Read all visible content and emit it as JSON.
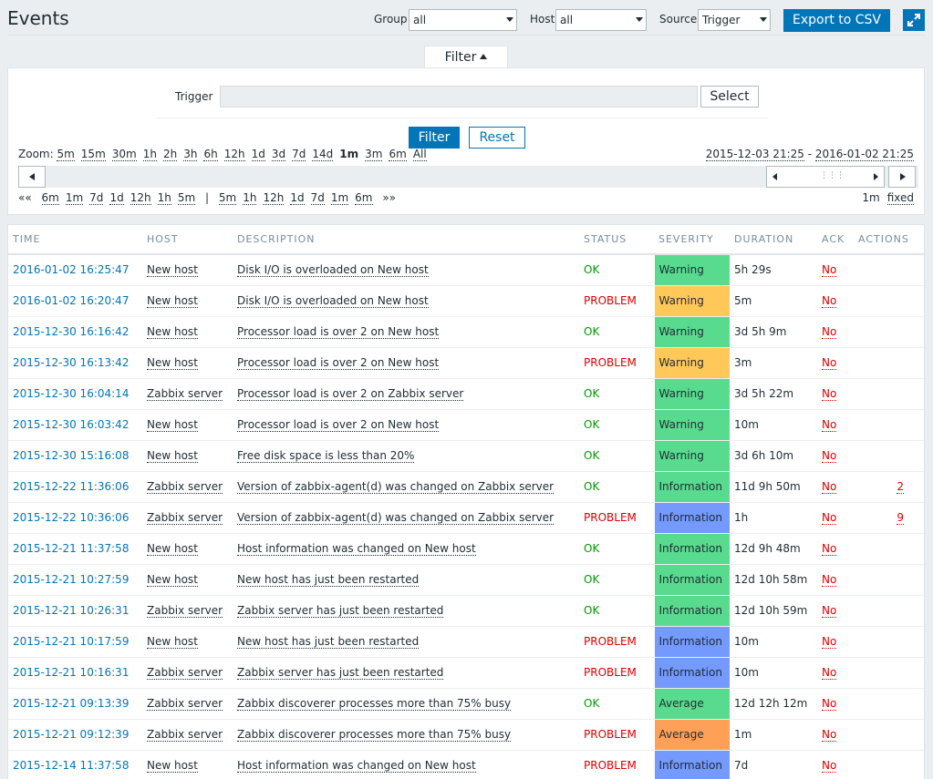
{
  "header": {
    "title": "Events",
    "group_label": "Group",
    "group_value": "all",
    "host_label": "Host",
    "host_value": "all",
    "source_label": "Source",
    "source_value": "Trigger",
    "export_label": "Export to CSV"
  },
  "filter": {
    "tab_label": "Filter",
    "trigger_label": "Trigger",
    "trigger_value": "",
    "select_label": "Select",
    "filter_button": "Filter",
    "reset_button": "Reset",
    "zoom_label": "Zoom:",
    "zoom_options": [
      "5m",
      "15m",
      "30m",
      "1h",
      "2h",
      "3h",
      "6h",
      "12h",
      "1d",
      "3d",
      "7d",
      "14d",
      "1m",
      "3m",
      "6m",
      "All"
    ],
    "zoom_active": "1m",
    "range_from": "2015-12-03 21:25",
    "range_sep": " - ",
    "range_to": "2016-01-02 21:25",
    "nav_back_start": "««",
    "nav_back": [
      "6m",
      "1m",
      "7d",
      "1d",
      "12h",
      "1h",
      "5m"
    ],
    "nav_sep": "|",
    "nav_forward": [
      "5m",
      "1h",
      "12h",
      "1d",
      "7d",
      "1m",
      "6m"
    ],
    "nav_forward_end": "»»",
    "period_label": "1m",
    "fixed_label": "fixed"
  },
  "colors": {
    "warning_ok": "#59db8f",
    "warning_problem": "#ffc859",
    "information_ok": "#59db8f",
    "information_problem": "#7499ff",
    "average_ok": "#59db8f",
    "average_problem": "#ffa059"
  },
  "table": {
    "columns": [
      "TIME",
      "HOST",
      "DESCRIPTION",
      "STATUS",
      "SEVERITY",
      "DURATION",
      "ACK",
      "ACTIONS"
    ],
    "rows": [
      {
        "time": "2016-01-02 16:25:47",
        "host": "New host",
        "description": "Disk I/O is overloaded on New host",
        "status": "OK",
        "severity": "Warning",
        "sev_color": "#59db8f",
        "duration": "5h 29s",
        "ack": "No",
        "actions": ""
      },
      {
        "time": "2016-01-02 16:20:47",
        "host": "New host",
        "description": "Disk I/O is overloaded on New host",
        "status": "PROBLEM",
        "severity": "Warning",
        "sev_color": "#ffc859",
        "duration": "5m",
        "ack": "No",
        "actions": ""
      },
      {
        "time": "2015-12-30 16:16:42",
        "host": "New host",
        "description": "Processor load is over 2 on New host",
        "status": "OK",
        "severity": "Warning",
        "sev_color": "#59db8f",
        "duration": "3d 5h 9m",
        "ack": "No",
        "actions": ""
      },
      {
        "time": "2015-12-30 16:13:42",
        "host": "New host",
        "description": "Processor load is over 2 on New host",
        "status": "PROBLEM",
        "severity": "Warning",
        "sev_color": "#ffc859",
        "duration": "3m",
        "ack": "No",
        "actions": ""
      },
      {
        "time": "2015-12-30 16:04:14",
        "host": "Zabbix server",
        "description": "Processor load is over 2 on Zabbix server",
        "status": "OK",
        "severity": "Warning",
        "sev_color": "#59db8f",
        "duration": "3d 5h 22m",
        "ack": "No",
        "actions": ""
      },
      {
        "time": "2015-12-30 16:03:42",
        "host": "New host",
        "description": "Processor load is over 2 on New host",
        "status": "OK",
        "severity": "Warning",
        "sev_color": "#59db8f",
        "duration": "10m",
        "ack": "No",
        "actions": ""
      },
      {
        "time": "2015-12-30 15:16:08",
        "host": "New host",
        "description": "Free disk space is less than 20%",
        "status": "OK",
        "severity": "Warning",
        "sev_color": "#59db8f",
        "duration": "3d 6h 10m",
        "ack": "No",
        "actions": ""
      },
      {
        "time": "2015-12-22 11:36:06",
        "host": "Zabbix server",
        "description": "Version of zabbix-agent(d) was changed on Zabbix server",
        "status": "OK",
        "severity": "Information",
        "sev_color": "#59db8f",
        "duration": "11d 9h 50m",
        "ack": "No",
        "actions": "2"
      },
      {
        "time": "2015-12-22 10:36:06",
        "host": "Zabbix server",
        "description": "Version of zabbix-agent(d) was changed on Zabbix server",
        "status": "PROBLEM",
        "severity": "Information",
        "sev_color": "#7499ff",
        "duration": "1h",
        "ack": "No",
        "actions": "9"
      },
      {
        "time": "2015-12-21 11:37:58",
        "host": "New host",
        "description": "Host information was changed on New host",
        "status": "OK",
        "severity": "Information",
        "sev_color": "#59db8f",
        "duration": "12d 9h 48m",
        "ack": "No",
        "actions": ""
      },
      {
        "time": "2015-12-21 10:27:59",
        "host": "New host",
        "description": "New host has just been restarted",
        "status": "OK",
        "severity": "Information",
        "sev_color": "#59db8f",
        "duration": "12d 10h 58m",
        "ack": "No",
        "actions": ""
      },
      {
        "time": "2015-12-21 10:26:31",
        "host": "Zabbix server",
        "description": "Zabbix server has just been restarted",
        "status": "OK",
        "severity": "Information",
        "sev_color": "#59db8f",
        "duration": "12d 10h 59m",
        "ack": "No",
        "actions": ""
      },
      {
        "time": "2015-12-21 10:17:59",
        "host": "New host",
        "description": "New host has just been restarted",
        "status": "PROBLEM",
        "severity": "Information",
        "sev_color": "#7499ff",
        "duration": "10m",
        "ack": "No",
        "actions": ""
      },
      {
        "time": "2015-12-21 10:16:31",
        "host": "Zabbix server",
        "description": "Zabbix server has just been restarted",
        "status": "PROBLEM",
        "severity": "Information",
        "sev_color": "#7499ff",
        "duration": "10m",
        "ack": "No",
        "actions": ""
      },
      {
        "time": "2015-12-21 09:13:39",
        "host": "Zabbix server",
        "description": "Zabbix discoverer processes more than 75% busy",
        "status": "OK",
        "severity": "Average",
        "sev_color": "#59db8f",
        "duration": "12d 12h 12m",
        "ack": "No",
        "actions": ""
      },
      {
        "time": "2015-12-21 09:12:39",
        "host": "Zabbix server",
        "description": "Zabbix discoverer processes more than 75% busy",
        "status": "PROBLEM",
        "severity": "Average",
        "sev_color": "#ffa059",
        "duration": "1m",
        "ack": "No",
        "actions": ""
      },
      {
        "time": "2015-12-14 11:37:58",
        "host": "New host",
        "description": "Host information was changed on New host",
        "status": "PROBLEM",
        "severity": "Information",
        "sev_color": "#7499ff",
        "duration": "7d",
        "ack": "No",
        "actions": ""
      }
    ]
  }
}
